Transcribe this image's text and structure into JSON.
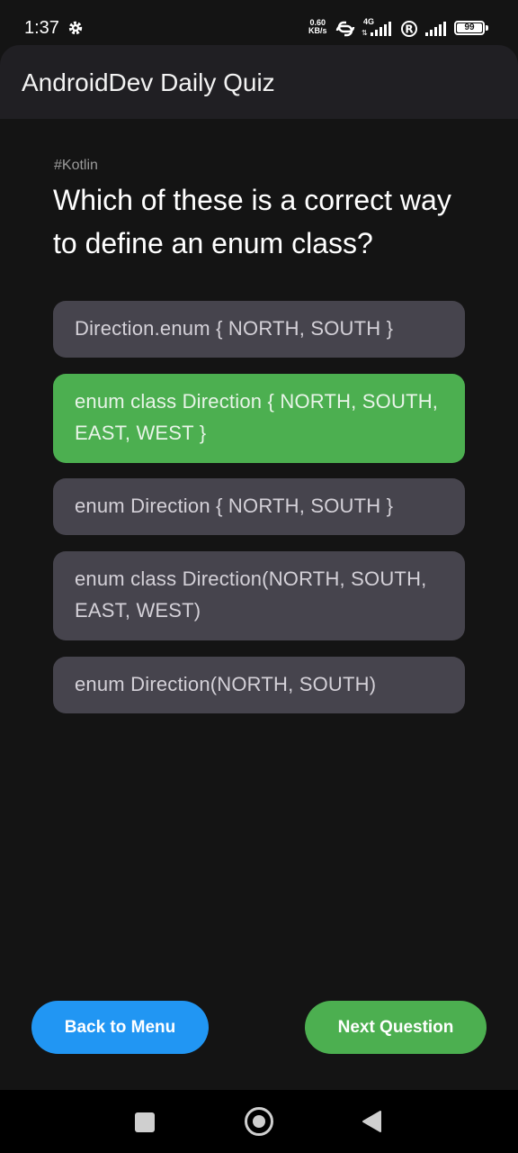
{
  "status_bar": {
    "time": "1:37",
    "net_speed_value": "0.60",
    "net_speed_unit": "KB/s",
    "network_type": "4G",
    "battery": "99"
  },
  "app_bar": {
    "title": "AndroidDev Daily Quiz"
  },
  "quiz": {
    "topic": "#Kotlin",
    "question": "Which of these is a correct way to define an enum class?",
    "options": [
      {
        "text": "Direction.enum { NORTH, SOUTH }",
        "state": "default"
      },
      {
        "text": "enum class Direction { NORTH, SOUTH, EAST, WEST }",
        "state": "correct"
      },
      {
        "text": "enum Direction { NORTH, SOUTH }",
        "state": "default"
      },
      {
        "text": "enum class Direction(NORTH, SOUTH, EAST, WEST)",
        "state": "default"
      },
      {
        "text": "enum Direction(NORTH, SOUTH)",
        "state": "default"
      }
    ]
  },
  "buttons": {
    "back_label": "Back to Menu",
    "next_label": "Next Question"
  },
  "colors": {
    "correct": "#4caf50",
    "option_bg": "#46444d",
    "back_button": "#2196f3",
    "next_button": "#4caf50",
    "background": "#141414"
  },
  "icons": {
    "settings": "gear-icon",
    "hotspot": "link-icon",
    "signal": "signal-icon",
    "roaming": "roaming-r-icon",
    "nav_recent": "square-icon",
    "nav_home": "circle-icon",
    "nav_back": "triangle-back-icon"
  }
}
